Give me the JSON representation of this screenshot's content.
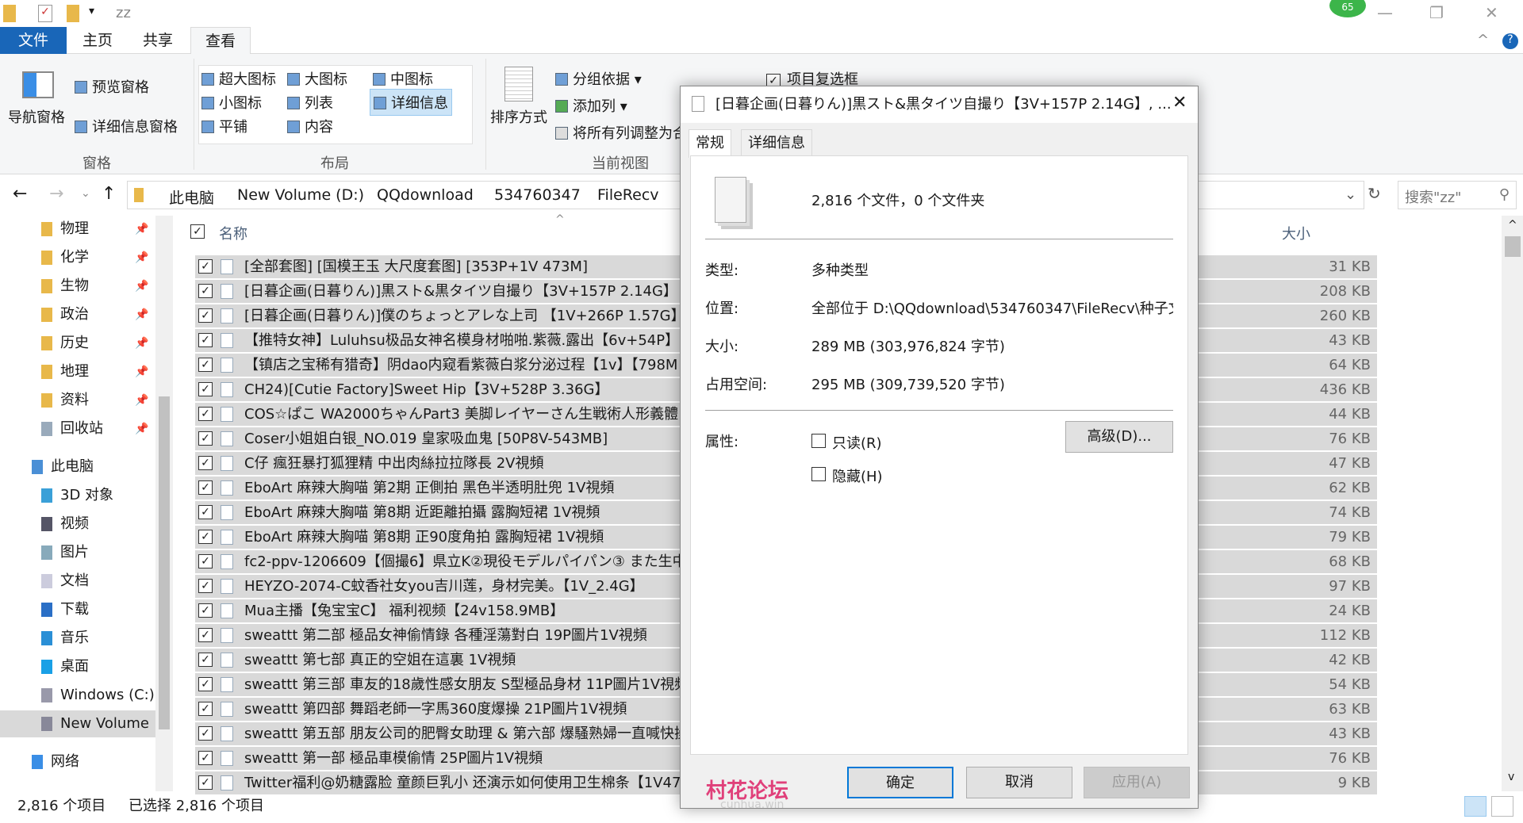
{
  "window": {
    "title": "zz",
    "badge": "65"
  },
  "ribbon_tabs": [
    "文件",
    "主页",
    "共享",
    "查看"
  ],
  "ribbon": {
    "pane_group": {
      "nav_pane": "导航窗格",
      "preview_pane": "预览窗格",
      "details_pane": "详细信息窗格",
      "label": "窗格"
    },
    "layout_group": {
      "items": [
        "超大图标",
        "大图标",
        "中图标",
        "小图标",
        "列表",
        "详细信息",
        "平铺",
        "内容"
      ],
      "selected": "详细信息",
      "label": "布局"
    },
    "view_group": {
      "sort_by": "排序方式",
      "group_by": "分组依据",
      "add_column": "添加列",
      "size_all": "将所有列调整为合",
      "label": "当前视图"
    },
    "show_group": {
      "item_checkboxes": "项目复选框"
    }
  },
  "address": {
    "crumbs": [
      "此电脑",
      "New Volume (D:)",
      "QQdownload",
      "534760347",
      "FileRecv"
    ],
    "search_placeholder": "搜索\"zz\""
  },
  "nav": {
    "quick": [
      {
        "label": "物理"
      },
      {
        "label": "化学"
      },
      {
        "label": "生物"
      },
      {
        "label": "政治"
      },
      {
        "label": "历史"
      },
      {
        "label": "地理"
      },
      {
        "label": "资料"
      },
      {
        "label": "回收站"
      }
    ],
    "pc": "此电脑",
    "pc_items": [
      "3D 对象",
      "视频",
      "图片",
      "文档",
      "下载",
      "音乐",
      "桌面",
      "Windows (C:)",
      "New Volume"
    ],
    "network": "网络"
  },
  "columns": {
    "name": "名称",
    "size": "大小"
  },
  "files": [
    {
      "name": "[全部套图] [国模王玉 大尺度套图] [353P+1V 473M]",
      "size": "31 KB"
    },
    {
      "name": "[日暮企画(日暮りん)]黒スト&黒タイツ自撮り【3V+157P 2.14G】",
      "size": "208 KB"
    },
    {
      "name": "[日暮企画(日暮りん)]僕のちょっとアレな上司 【1V+266P 1.57G】",
      "size": "260 KB"
    },
    {
      "name": "【推特女神】Luluhsu极品女神名模身材啪啪.紫薇.露出【6v+54P】",
      "size": "43 KB"
    },
    {
      "name": "【镇店之宝稀有猎奇】阴dao内窥看紫薇白浆分泌过程【1v】【798M",
      "size": "64 KB"
    },
    {
      "name": "CH24)[Cutie Factory]Sweet Hip【3V+528P 3.36G】",
      "size": "436 KB"
    },
    {
      "name": "COS☆ぱこ WA2000ちゃんPart3 美脚レイヤーさん生戦術人形義體",
      "size": "44 KB"
    },
    {
      "name": "Coser小姐姐白银_NO.019 皇家吸血鬼 [50P8V-543MB]",
      "size": "76 KB"
    },
    {
      "name": "C仔 瘋狂暴打狐狸精 中出肉絲拉拉隊長 2V視頻",
      "size": "47 KB"
    },
    {
      "name": "EboArt 麻辣大胸喵 第2期 正側拍 黑色半透明肚兜 1V視頻",
      "size": "62 KB"
    },
    {
      "name": "EboArt 麻辣大胸喵 第8期 近距離拍攝 露胸短裙 1V視頻",
      "size": "74 KB"
    },
    {
      "name": "EboArt 麻辣大胸喵 第8期 正90度角拍 露胸短裙 1V視頻",
      "size": "79 KB"
    },
    {
      "name": "fc2-ppv-1206609【個撮6】県立K②現役モデルパイパン③ また生中",
      "size": "68 KB"
    },
    {
      "name": "HEYZO-2074-C蚊香社女you吉川莲，身材完美。【1V_2.4G】",
      "size": "97 KB"
    },
    {
      "name": "Mua主播【兔宝宝C】 福利视频【24v158.9MB】",
      "size": "24 KB"
    },
    {
      "name": "sweattt 第二部 極品女神偷情錄 各種淫蕩對白 19P圖片1V視頻",
      "size": "112 KB"
    },
    {
      "name": "sweattt 第七部 真正的空姐在這裏 1V視頻",
      "size": "42 KB"
    },
    {
      "name": "sweattt 第三部 車友的18歲性感女朋友 S型極品身材 11P圖片1V視頻",
      "size": "54 KB"
    },
    {
      "name": "sweattt 第四部 舞蹈老師一字馬360度爆操 21P圖片1V視頻",
      "size": "63 KB"
    },
    {
      "name": "sweattt 第五部 朋友公司的肥臀女助理 & 第六部 爆騷熟婦一直喊快操",
      "size": "43 KB"
    },
    {
      "name": "sweattt 第一部 極品車模偷情 25P圖片1V視頻",
      "size": "76 KB"
    },
    {
      "name": "Twitter福利@奶糖露脸 童颜巨乳小 还演示如何使用卫生棉条【1V47",
      "size": "9 KB"
    }
  ],
  "status": {
    "count": "2,816 个项目",
    "selected": "已选择 2,816 个项目"
  },
  "dialog": {
    "title": "[日暮企画(日暮りん)]黒スト&黒タイツ自撮り【3V+157P 2.14G】, ...",
    "tabs": [
      "常规",
      "详细信息"
    ],
    "summary": "2,816 个文件，0 个文件夹",
    "type_label": "类型:",
    "type": "多种类型",
    "location_label": "位置:",
    "location": "全部位于 D:\\QQdownload\\534760347\\FileRecv\\种子文",
    "size_label": "大小:",
    "size": "289 MB (303,976,824 字节)",
    "disk_label": "占用空间:",
    "disk": "295 MB (309,739,520 字节)",
    "attr_label": "属性:",
    "readonly": "只读(R)",
    "hidden": "隐藏(H)",
    "advanced": "高级(D)...",
    "ok": "确定",
    "cancel": "取消",
    "apply": "应用(A)"
  },
  "watermark": {
    "text": "村花论坛",
    "sub": "cunhua.win"
  }
}
